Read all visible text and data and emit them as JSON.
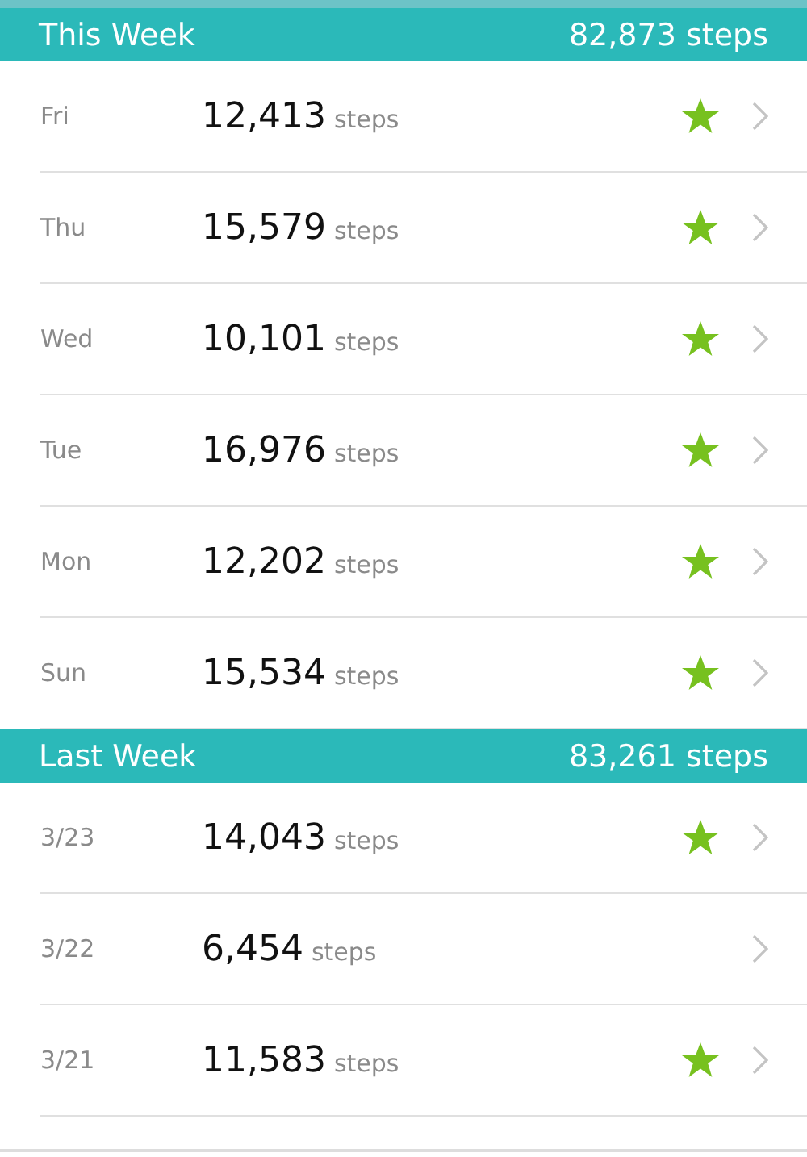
{
  "sections": [
    {
      "title": "This Week",
      "total": "82,873 steps",
      "rows": [
        {
          "day": "Fri",
          "count": "12,413",
          "unit": "steps",
          "goal_met": true
        },
        {
          "day": "Thu",
          "count": "15,579",
          "unit": "steps",
          "goal_met": true
        },
        {
          "day": "Wed",
          "count": "10,101",
          "unit": "steps",
          "goal_met": true
        },
        {
          "day": "Tue",
          "count": "16,976",
          "unit": "steps",
          "goal_met": true
        },
        {
          "day": "Mon",
          "count": "12,202",
          "unit": "steps",
          "goal_met": true
        },
        {
          "day": "Sun",
          "count": "15,534",
          "unit": "steps",
          "goal_met": true
        }
      ]
    },
    {
      "title": "Last Week",
      "total": "83,261 steps",
      "rows": [
        {
          "day": "3/23",
          "count": "14,043",
          "unit": "steps",
          "goal_met": true
        },
        {
          "day": "3/22",
          "count": "6,454",
          "unit": "steps",
          "goal_met": false
        },
        {
          "day": "3/21",
          "count": "11,583",
          "unit": "steps",
          "goal_met": true
        }
      ]
    }
  ]
}
